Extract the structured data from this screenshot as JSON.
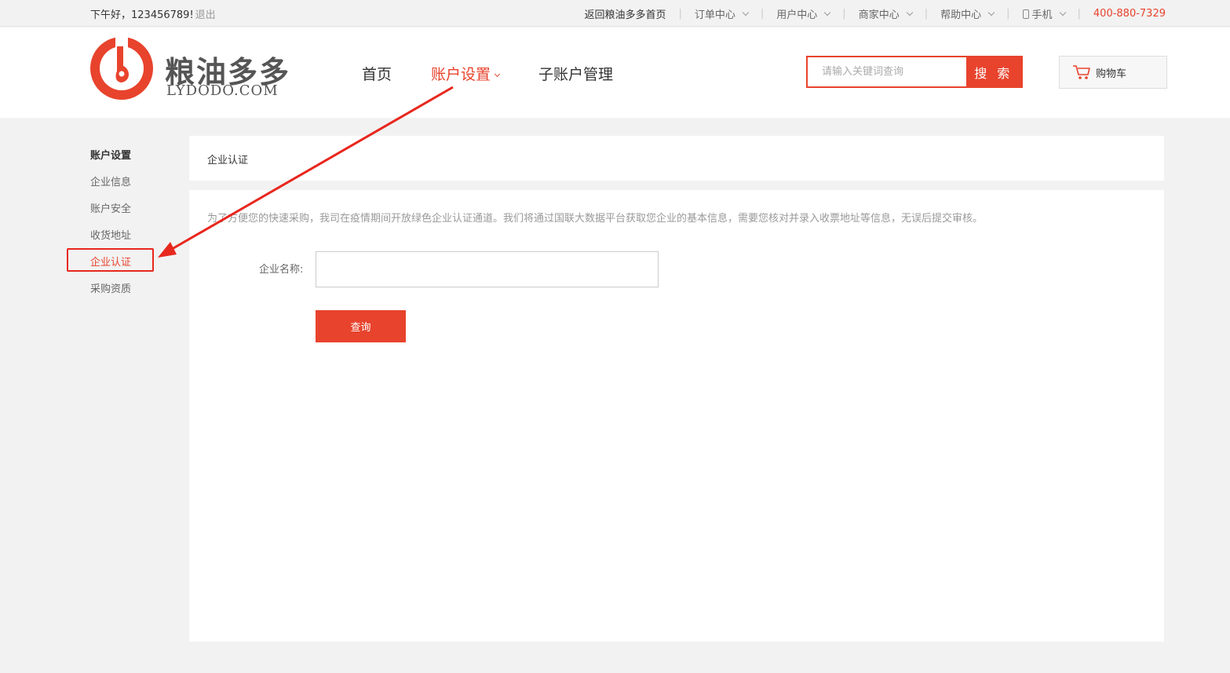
{
  "topbar": {
    "greeting": "下午好，123456789!",
    "logout": "退出",
    "home_link": "返回粮油多多首页",
    "order_center": "订单中心",
    "user_center": "用户中心",
    "merchant_center": "商家中心",
    "help_center": "帮助中心",
    "mobile": "手机",
    "sep": "|",
    "phone": "400-880-7329"
  },
  "header": {
    "brand": "粮油多多",
    "domain": "LYDODO.COM",
    "nav": {
      "home": "首页",
      "account_settings": "账户设置",
      "sub_accounts": "子账户管理"
    },
    "search": {
      "placeholder": "请输入关键词查询",
      "button": "搜 索"
    },
    "cart": "购物车"
  },
  "sidebar": {
    "title": "账户设置",
    "items": [
      {
        "label": "企业信息"
      },
      {
        "label": "账户安全"
      },
      {
        "label": "收货地址"
      },
      {
        "label": "企业认证"
      },
      {
        "label": "采购资质"
      }
    ]
  },
  "content": {
    "heading": "企业认证",
    "notice": "为了方便您的快速采购，我司在疫情期间开放绿色企业认证通道。我们将通过国联大数据平台获取您企业的基本信息，需要您核对并录入收票地址等信息，无误后提交审核。",
    "company_label": "企业名称:",
    "company_value": "",
    "query_button": "查询"
  },
  "colors": {
    "accent": "#e8432d",
    "annotation": "#e8271e"
  }
}
